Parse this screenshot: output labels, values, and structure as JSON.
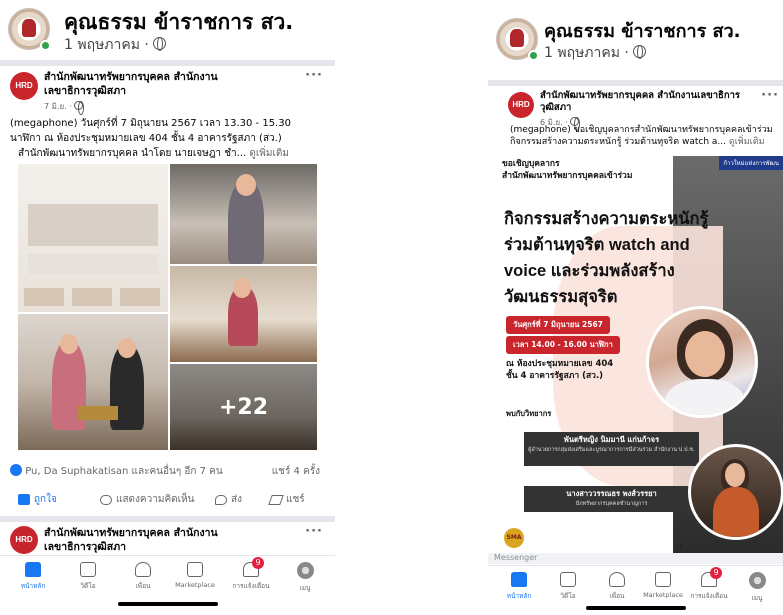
{
  "group": {
    "name": "คุณธรรม ข้าราชการ สว.",
    "date": "1 พฤษภาคม ·"
  },
  "left": {
    "post": {
      "page_name": "สำนักพัฒนาทรัพยากรบุคคล สำนักงานเลขาธิการวุฒิสภา",
      "time": "7 มิ.ย. ·",
      "text_line1": "(megaphone) วันศุกร์ที่ 7 มิถุนายน 2567 เวลา 13.30 - 15.30",
      "text_line2": "นาฬิกา ณ ห้องประชุมหมายเลข 404 ชั้น 4 อาคารรัฐสภา (สว.)",
      "text_line3": "สำนักพัฒนาทรัพยากรบุคคล นำโดย นายเจษฎา ชำ...",
      "see_more": "ดูเพิ่มเติม",
      "more_photos": "+22",
      "reactions_text": "Pu, Da Suphakatisan และคนอื่นๆ อีก 7 คน",
      "shares_text": "แชร์ 4 ครั้ง",
      "actions": {
        "like": "ถูกใจ",
        "comment": "แสดงความคิดเห็น",
        "send": "ส่ง",
        "share": "แชร์"
      }
    },
    "next_post": {
      "page_name": "สำนักพัฒนาทรัพยากรบุคคล สำนักงานเลขาธิการวุฒิสภา"
    }
  },
  "right": {
    "post": {
      "page_name": "สำนักพัฒนาทรัพยากรบุคคล สำนักงานเลขาธิการวุฒิสภา",
      "time": "6 มิ.ย. ·",
      "text_line1": "(megaphone) ขอเชิญบุคลากรสำนักพัฒนาทรัพยากรบุคคลเข้าร่วม",
      "text_line2": "กิจกรรมสร้างความตระหนักรู้ ร่วมต้านทุจริต watch a...",
      "see_more": "ดูเพิ่มเติม"
    },
    "poster": {
      "invite_line1": "ขอเชิญบุคลากร",
      "invite_line2": "สำนักพัฒนาทรัพยากรบุคคลเข้าร่วม",
      "tag": "ก้าวใหม่แห่งการพัฒน",
      "headline1": "กิจกรรมสร้างความตระหนักรู้",
      "headline2": "ร่วมต้านทุจริต watch and",
      "headline3": "voice และร่วมพลังสร้าง",
      "headline4": "วัฒนธรรมสุจริต",
      "date_pill": "วันศุกร์ที่ 7 มิถุนายน 2567",
      "time_pill": "เวลา 14.00 - 16.00 นาฬิกา",
      "venue1": "ณ ห้องประชุมหมายเลข 404",
      "venue2": "ชั้น 4 อาคารรัฐสภา (สว.)",
      "speakers_label": "พบกับวิทยากร",
      "speaker1_name": "พันตรีหญิง นิมมานี แก่นก้าจร",
      "speaker1_role": "ผู้อำนวยการกลุ่มส่งเสริมและบูรณาการการมีส่วนร่วม สำนักงาน ป.ป.ช.",
      "speaker2_name": "นางสาววรรณธร พงส์วรรยา",
      "speaker2_role": "นักทรัพยากรบุคคลชำนาญการ",
      "logo_text": "SMA"
    },
    "messenger_label": "Messenger"
  },
  "nav": {
    "items": [
      {
        "label": "หน้าหลัก",
        "icon": "home-icon"
      },
      {
        "label": "วิดีโอ",
        "icon": "video-icon"
      },
      {
        "label": "เพื่อน",
        "icon": "friends-icon"
      },
      {
        "label": "Marketplace",
        "icon": "marketplace-icon"
      },
      {
        "label": "การแจ้งเตือน",
        "icon": "bell-icon",
        "badge": "9"
      },
      {
        "label": "เมนู",
        "icon": "menu-avatar"
      }
    ]
  },
  "colors": {
    "accent": "#1877f2",
    "brand_red": "#c9252c",
    "online": "#31a24c"
  }
}
